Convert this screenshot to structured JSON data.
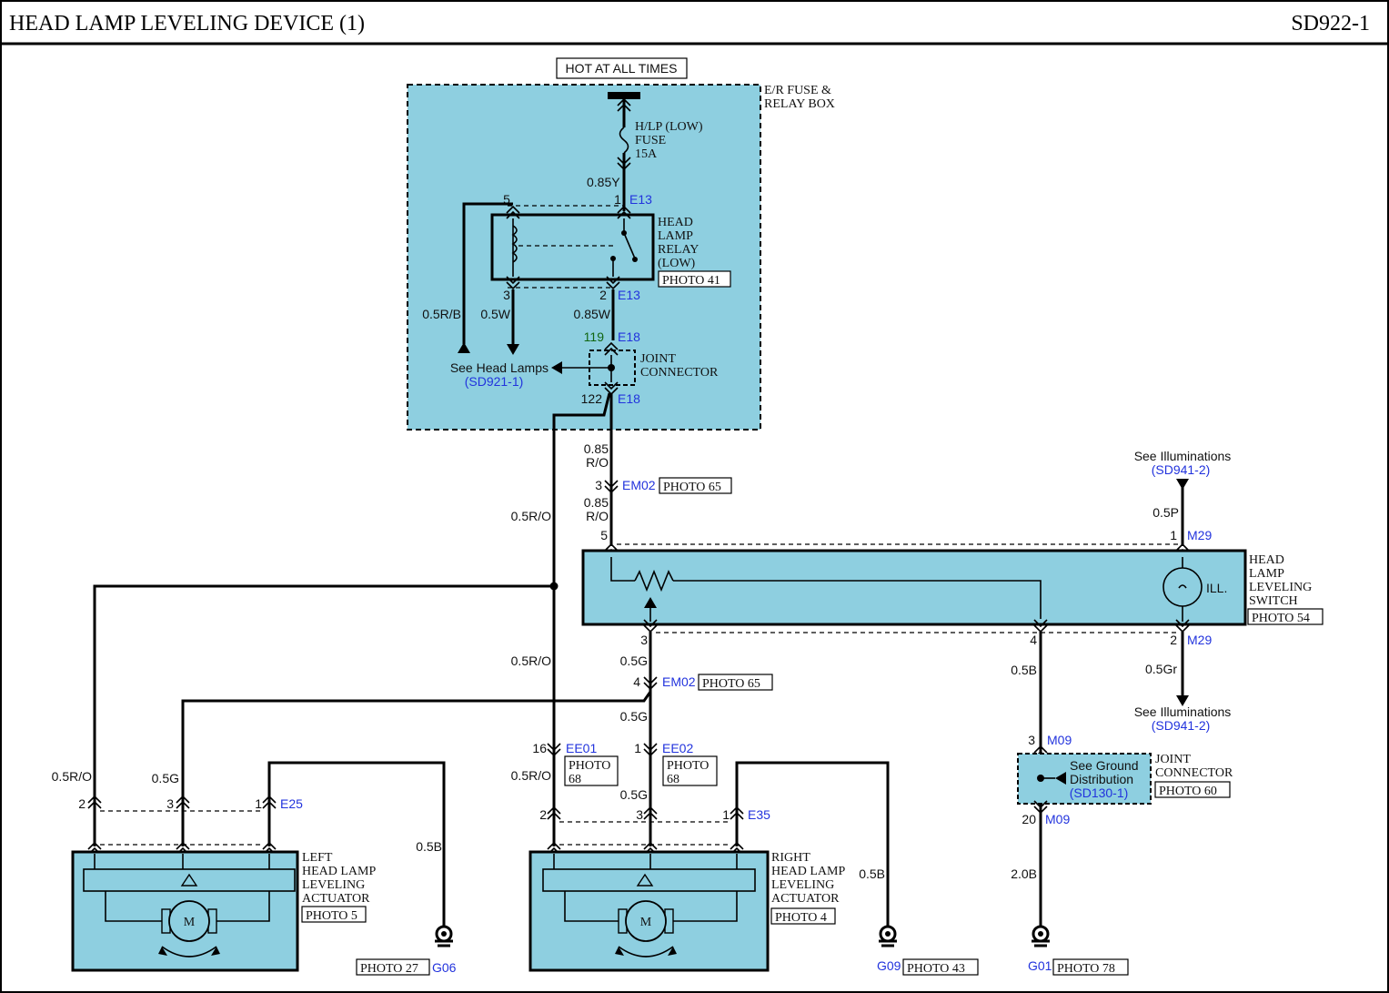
{
  "header": {
    "title": "HEAD LAMP LEVELING DEVICE (1)",
    "code": "SD922-1"
  },
  "power": {
    "source": "HOT AT ALL TIMES"
  },
  "fuse_box": {
    "line1": "E/R FUSE &",
    "line2": "RELAY BOX"
  },
  "fuse": {
    "line1": "H/LP (LOW)",
    "line2": "FUSE",
    "line3": "15A"
  },
  "relay": {
    "line1": "HEAD",
    "line2": "LAMP",
    "line3": "RELAY",
    "line4": "(LOW)",
    "photo": "PHOTO 41",
    "pin5": "5",
    "pin1": "1",
    "pin3": "3",
    "pin2": "2",
    "conn_top": "E13",
    "conn_bottom": "E13"
  },
  "joint_e18": {
    "line1": "JOINT",
    "line2": "CONNECTOR",
    "pin_top": "119",
    "pin_bottom": "122",
    "conn_top": "E18",
    "conn_bottom": "E18"
  },
  "see_head_lamps": {
    "label": "See Head Lamps",
    "ref": "(SD921-1)"
  },
  "wires": {
    "w085y": "0.85Y",
    "w05rb": "0.5R/B",
    "w05w": "0.5W",
    "w085w": "0.85W",
    "w085ro_a1": "0.85",
    "w085ro_a2": "R/O",
    "w085ro_b1": "0.85",
    "w085ro_b2": "R/O",
    "w05ro_main": "0.5R/O",
    "w05ro_mid": "0.5R/O",
    "w05ro_left": "0.5R/O",
    "w05ro_right": "0.5R/O",
    "w05g_sw": "0.5G",
    "w05g_mid": "0.5G",
    "w05g_left": "0.5G",
    "w05g_right": "0.5G",
    "w05b_sw": "0.5B",
    "w05b_left": "0.5B",
    "w05b_right": "0.5B",
    "w20b": "2.0B",
    "w05p": "0.5P",
    "w05gr": "0.5Gr"
  },
  "em02_top": {
    "pin": "3",
    "conn": "EM02",
    "photo": "PHOTO 65"
  },
  "em02_mid": {
    "pin": "4",
    "conn": "EM02",
    "photo": "PHOTO 65"
  },
  "switch": {
    "line1": "HEAD",
    "line2": "LAMP",
    "line3": "LEVELING",
    "line4": "SWITCH",
    "photo": "PHOTO 54",
    "ill": "ILL.",
    "pin5": "5",
    "pin1": "1",
    "pin3": "3",
    "pin4": "4",
    "pin2": "2",
    "conn_top": "M29",
    "conn_bottom": "M29"
  },
  "illum_top": {
    "label": "See Illuminations",
    "ref": "(SD941-2)"
  },
  "illum_bottom": {
    "label": "See Illuminations",
    "ref": "(SD941-2)"
  },
  "ee01": {
    "pin": "16",
    "conn": "EE01",
    "photo1": "PHOTO",
    "photo2": "68"
  },
  "ee02": {
    "pin": "1",
    "conn": "EE02",
    "photo1": "PHOTO",
    "photo2": "68"
  },
  "joint_m09": {
    "line1": "JOINT",
    "line2": "CONNECTOR",
    "photo": "PHOTO 60",
    "pin_top": "3",
    "pin_bottom": "20",
    "conn_top": "M09",
    "conn_bottom": "M09",
    "ground_line1": "See Ground",
    "ground_line2": "Distribution",
    "ground_ref": "(SD130-1)"
  },
  "left_actuator": {
    "line1": "LEFT",
    "line2": "HEAD LAMP",
    "line3": "LEVELING",
    "line4": "ACTUATOR",
    "photo": "PHOTO 5",
    "pin2": "2",
    "pin3": "3",
    "pin1": "1",
    "conn": "E25",
    "motor": "M"
  },
  "right_actuator": {
    "line1": "RIGHT",
    "line2": "HEAD LAMP",
    "line3": "LEVELING",
    "line4": "ACTUATOR",
    "photo": "PHOTO 4",
    "pin2": "2",
    "pin3": "3",
    "pin1": "1",
    "conn": "E35",
    "motor": "M"
  },
  "grounds": {
    "g06": {
      "name": "G06",
      "photo": "PHOTO 27"
    },
    "g09": {
      "name": "G09",
      "photo": "PHOTO 43"
    },
    "g01": {
      "name": "G01",
      "photo": "PHOTO 78"
    }
  },
  "colors": {
    "component_fill": "#8ecfe0",
    "connector_label": "#2233dd",
    "wire": "#000000"
  }
}
